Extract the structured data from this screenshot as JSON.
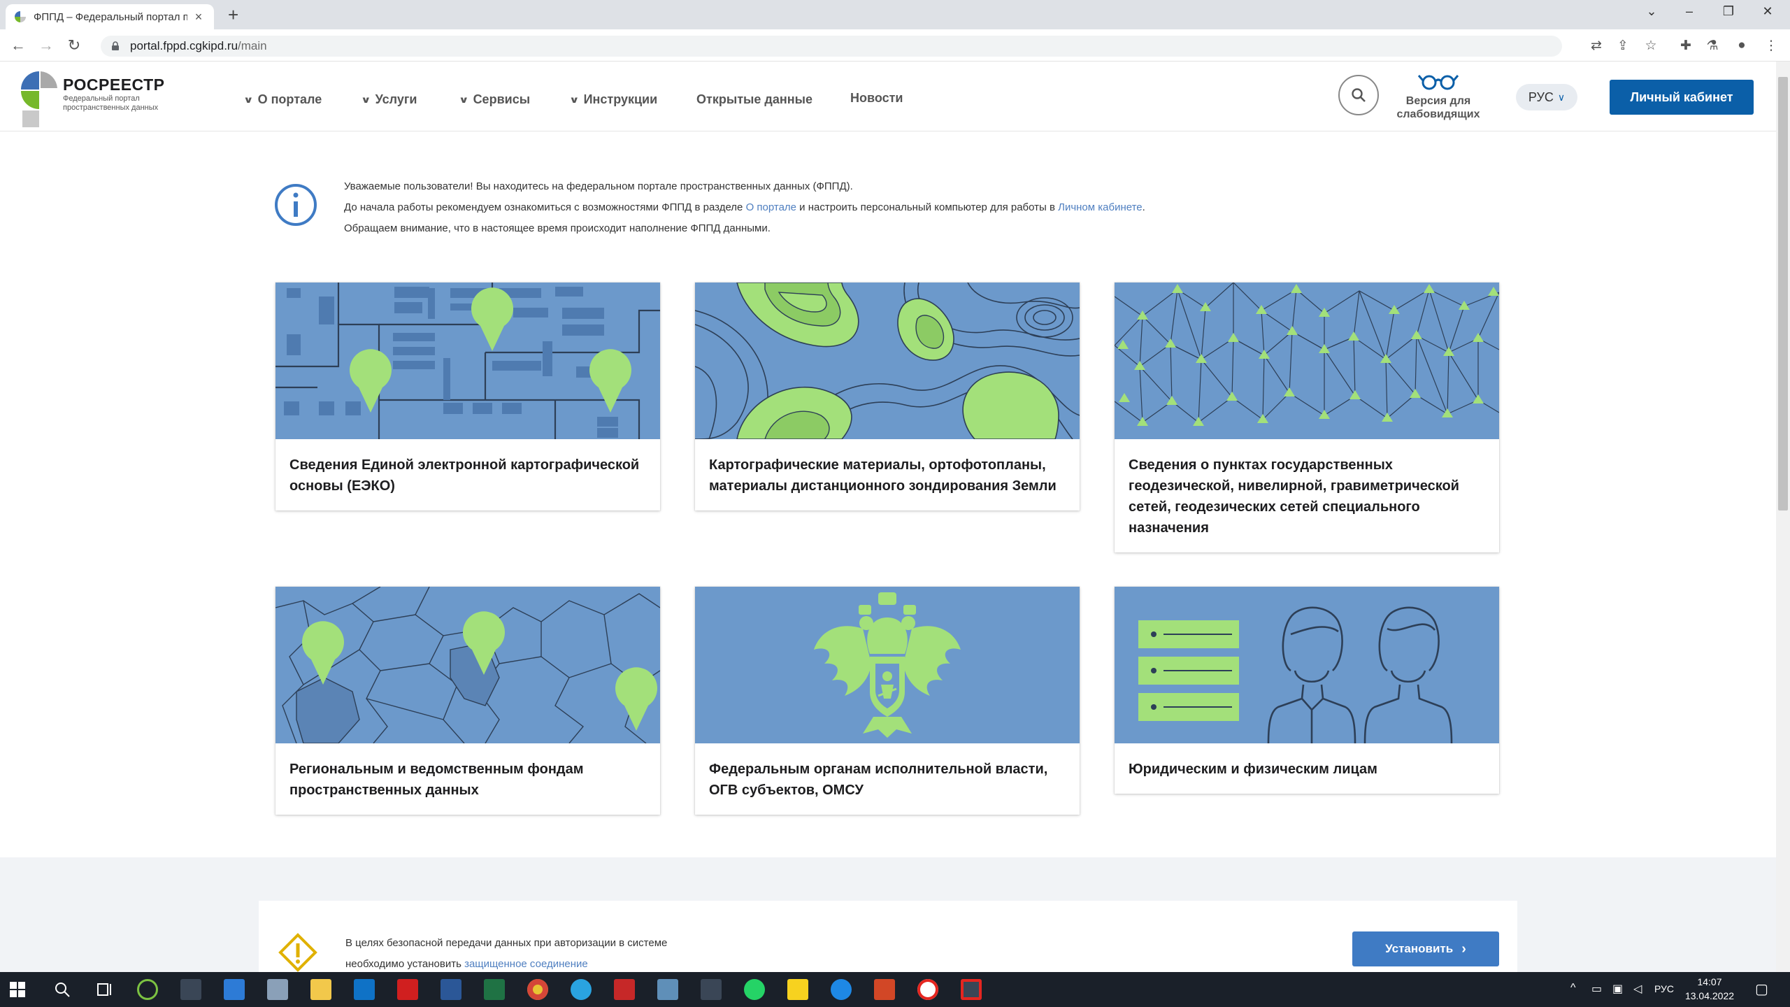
{
  "browser": {
    "tab_title": "ФППД – Федеральный портал пространственных данных",
    "url_host": "portal.fppd.cgkipd.ru",
    "url_path": "/main"
  },
  "header": {
    "logo_title": "РОСРЕЕСТР",
    "logo_line1": "Федеральный портал",
    "logo_line2": "пространственных данных",
    "menu": [
      {
        "label": "О портале",
        "dropdown": true
      },
      {
        "label": "Услуги",
        "dropdown": true
      },
      {
        "label": "Сервисы",
        "dropdown": true
      },
      {
        "label": "Инструкции",
        "dropdown": true
      },
      {
        "label": "Открытые данные",
        "dropdown": false
      },
      {
        "label": "Новости",
        "dropdown": false
      }
    ],
    "vision_line1": "Версия для",
    "vision_line2": "слабовидящих",
    "lang": "РУС",
    "cabinet": "Личный кабинет"
  },
  "info": {
    "line1": "Уважаемые пользователи! Вы находитесь на федеральном портале пространственных данных (ФППД).",
    "line2_a": "До начала работы рекомендуем ознакомиться с возможностями ФППД в разделе ",
    "line2_link1": "О портале",
    "line2_b": " и настроить персональный компьютер для работы в ",
    "line2_link2": "Личном кабинете",
    "line2_c": ".",
    "line3": "Обращаем внимание, что в настоящее время происходит наполнение ФППД данными."
  },
  "cards": [
    {
      "title": "Сведения Единой электронной картографической основы (ЕЭКО)",
      "icon": "map-pins-illustration"
    },
    {
      "title": "Картографические материалы, ортофотопланы, материалы дистанционного зондирования Земли",
      "icon": "topographic-contours-illustration"
    },
    {
      "title": "Сведения о пунктах государственных геодезической, нивелирной, гравиметрической сетей, геодезических сетей специального назначения",
      "icon": "geodetic-network-illustration"
    },
    {
      "title": "Региональным и ведомственным фондам пространственных данных",
      "icon": "regional-map-illustration"
    },
    {
      "title": "Федеральным органам исполнительной власти, ОГВ субъектов, ОМСУ",
      "icon": "coat-of-arms-illustration"
    },
    {
      "title": "Юридическим и физическим лицам",
      "icon": "people-list-illustration"
    }
  ],
  "notice": {
    "line1": "В целях безопасной передачи данных при авторизации в системе",
    "line2_a": "необходимо установить ",
    "line2_link": "защищенное соединение",
    "button": "Установить"
  },
  "taskbar": {
    "lang": "РУС",
    "time": "14:07",
    "date": "13.04.2022"
  },
  "colors": {
    "card_bg": "#6c99cb",
    "accent_green": "#a3e07a",
    "primary_button": "#0b5fa8",
    "link": "#4f7fc0"
  }
}
